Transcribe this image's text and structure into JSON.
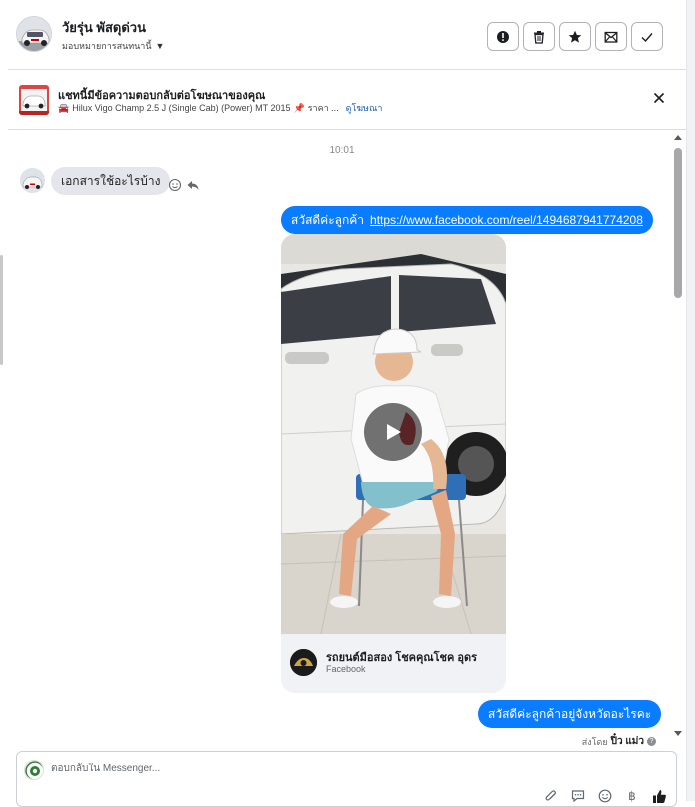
{
  "header": {
    "contact_name": "วัยรุ่น พัสดุด่วน",
    "assign_label": "มอบหมายการสนทนานี้",
    "actions": [
      "spam",
      "delete",
      "star",
      "mark-unread",
      "done"
    ]
  },
  "ad_reply": {
    "title": "แชทนี้มีข้อความตอบกลับต่อโฆษณาของคุณ",
    "car_text": "Hilux Vigo Champ 2.5 J (Single Cab) (Power) MT 2015",
    "price_text": "ราคา ...",
    "view_ad_label": "ดูโฆษณา"
  },
  "chat": {
    "time": "10:01",
    "incoming_message": "เอกสารใช้อะไรบ้าง",
    "outgoing_greeting": "สวัสดีค่ะลูกค้า",
    "outgoing_link": "https://www.facebook.com/reel/1494687941774208",
    "card": {
      "page_name": "รถยนต์มือสอง โชคคุณโชค อุดร",
      "source": "Facebook"
    },
    "outgoing_question": "สวัสดีค่ะลูกค้าอยู่จังหวัดอะไรคะ",
    "sent_by_label": "ส่งโดย",
    "sent_by_name": "ปิ๋ว แม่ว"
  },
  "composer": {
    "placeholder": "ตอบกลับใน Messenger..."
  },
  "colors": {
    "accent_blue": "#0a7cff",
    "link_blue": "#1a5fb4",
    "incoming_bubble": "#e4e6eb"
  }
}
